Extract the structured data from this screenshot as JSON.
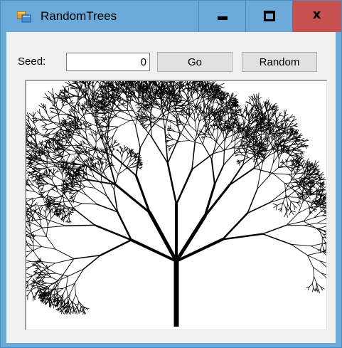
{
  "window": {
    "title": "RandomTrees",
    "icon": "windows-form-icon",
    "controls": {
      "minimize_icon": "minimize-icon",
      "maximize_icon": "maximize-icon",
      "close_glyph": "x"
    },
    "colors": {
      "titlebar": "#6aa9d8",
      "close": "#c75050",
      "client": "#f0f0f0"
    }
  },
  "toolbar": {
    "seed_label": "Seed:",
    "seed_value": "0",
    "go_label": "Go",
    "random_label": "Random"
  },
  "canvas": {
    "content": "random-fractal-tree",
    "background": "#ffffff",
    "ink": "#000000"
  }
}
